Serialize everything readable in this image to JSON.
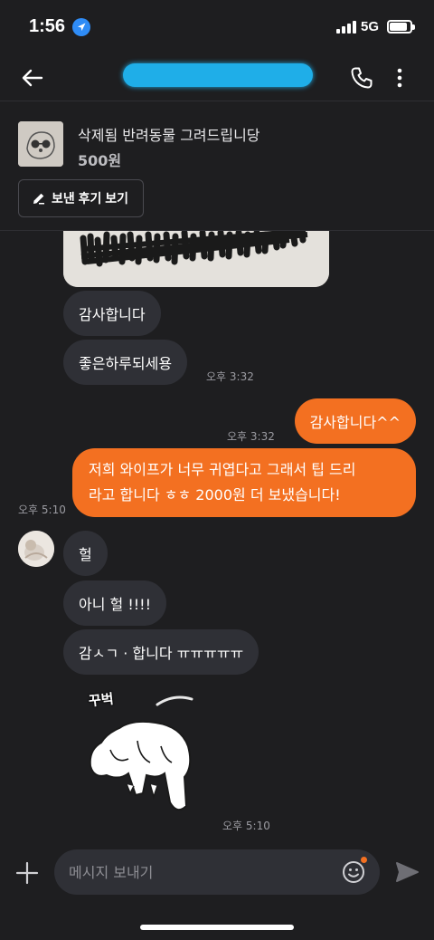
{
  "status_bar": {
    "time": "1:56",
    "network": "5G",
    "icons": [
      "location-arrow-icon",
      "signal-icon",
      "battery-icon"
    ]
  },
  "header": {
    "icons": [
      "back-arrow-icon",
      "phone-icon",
      "more-vertical-icon"
    ]
  },
  "product": {
    "title": "삭제됨 반려동물 그려드립니당",
    "price": "500원",
    "review_button_label": "보낸 후기 보기",
    "review_icon": "pencil-icon"
  },
  "messages": [
    {
      "side": "received",
      "text": "감사합니다"
    },
    {
      "side": "received",
      "text": "좋은하루되세용",
      "time": "오후 3:32"
    },
    {
      "side": "sent",
      "text": "감사합니다^^",
      "time": "오후 3:32"
    },
    {
      "side": "sent",
      "lines": [
        "저희 와이프가 너무 귀엽다고 그래서 팁 드리",
        "라고 합니다 ㅎㅎ 2000원 더 보냈습니다!"
      ],
      "time": "오후 5:10"
    },
    {
      "side": "received",
      "text": "헐"
    },
    {
      "side": "received",
      "text": "아니 헐 !!!!"
    },
    {
      "side": "received",
      "text": "감ㅅㄱ · 합니다 ㅠㅠㅠㅠㅠ"
    },
    {
      "side": "received",
      "sticker_caption": "꾸벅",
      "sticker_icon": "bowing-dog-sticker",
      "time": "오후 5:10"
    }
  ],
  "composer": {
    "placeholder": "메시지 보내기",
    "icons": [
      "plus-icon",
      "emoji-icon",
      "send-icon"
    ],
    "accent": "#f37021"
  },
  "colors": {
    "background": "#1e1e20",
    "received_bubble": "#2f3036",
    "sent_bubble": "#f37021",
    "redaction": "#1faee8"
  }
}
